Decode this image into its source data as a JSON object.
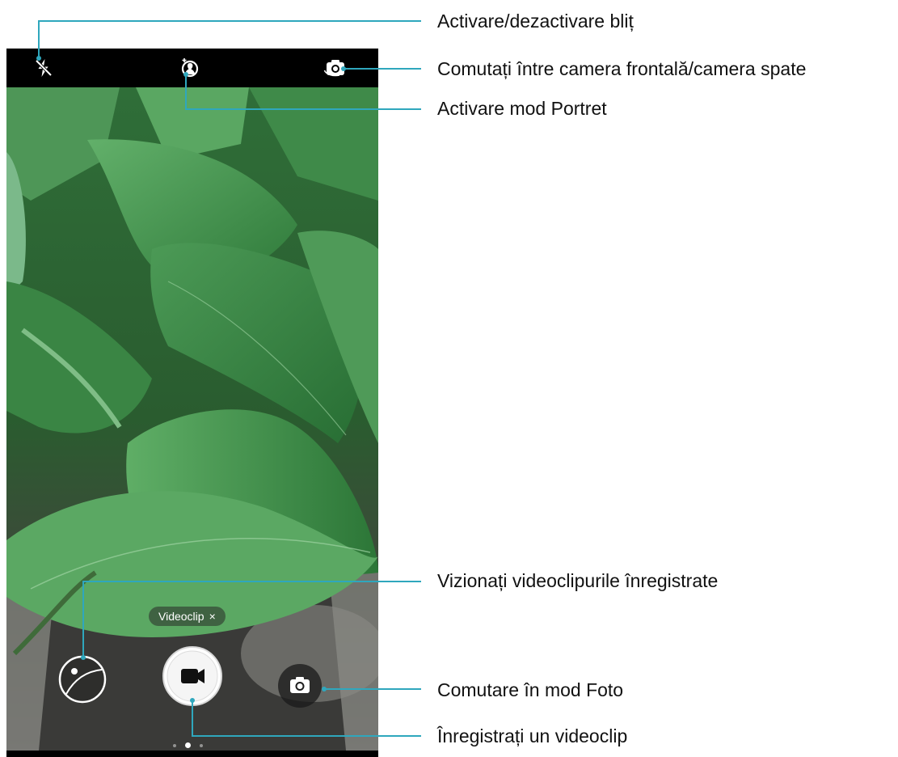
{
  "callouts": {
    "flash": "Activare/dezactivare bliț",
    "switch_camera": "Comutați între camera frontală/camera spate",
    "portrait": "Activare mod Portret",
    "gallery": "Vizionați videoclipurile înregistrate",
    "photo_mode": "Comutare în mod Foto",
    "record": "Înregistrați un videoclip"
  },
  "camera": {
    "mode_chip_label": "Videoclip",
    "mode_chip_close": "×",
    "top_icons": [
      "flash-off-icon",
      "portrait-mode-icon",
      "switch-camera-icon"
    ],
    "bottom_controls": [
      "gallery-thumbnail",
      "record-button",
      "photo-mode-button"
    ],
    "mode_pager_pages": 3,
    "mode_pager_active_index": 1
  },
  "colors": {
    "callout_line": "#2fa7bd",
    "topbar": "#000000",
    "record_icon": "#111111"
  }
}
